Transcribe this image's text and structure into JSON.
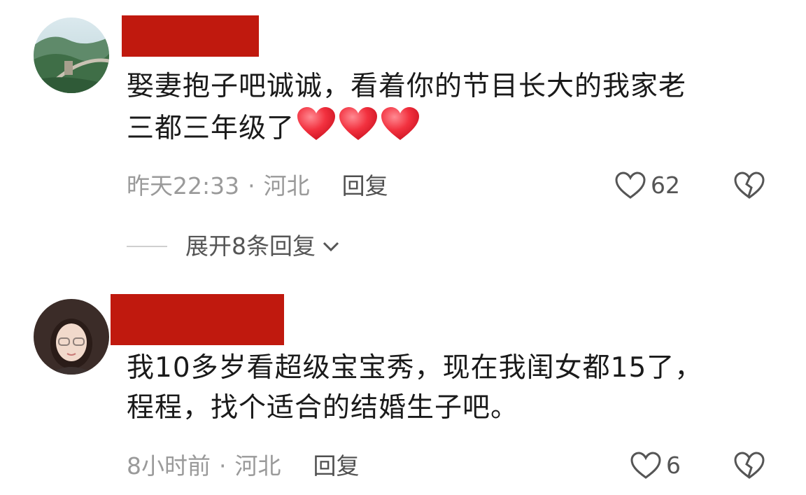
{
  "comments": [
    {
      "text_line1": "娶妻抱子吧诚诚，看着你的节目长大的我家老",
      "text_line2": "三都三年级了",
      "time": "昨天22:33",
      "location": "河北",
      "reply_label": "回复",
      "likes": "62",
      "avatar_icon": "great-wall-avatar"
    },
    {
      "text_line1": "我10多岁看超级宝宝秀，现在我闺女都15了，",
      "text_line2": "程程，找个适合的结婚生子吧。",
      "time": "8小时前",
      "location": "河北",
      "reply_label": "回复",
      "likes": "6",
      "avatar_icon": "person-avatar"
    }
  ],
  "expand_replies": "展开8条回复",
  "colors": {
    "redaction": "#c0190e",
    "text": "#1a1a1a",
    "meta": "#9a9a9a",
    "heart_emoji": "#f0343f"
  }
}
